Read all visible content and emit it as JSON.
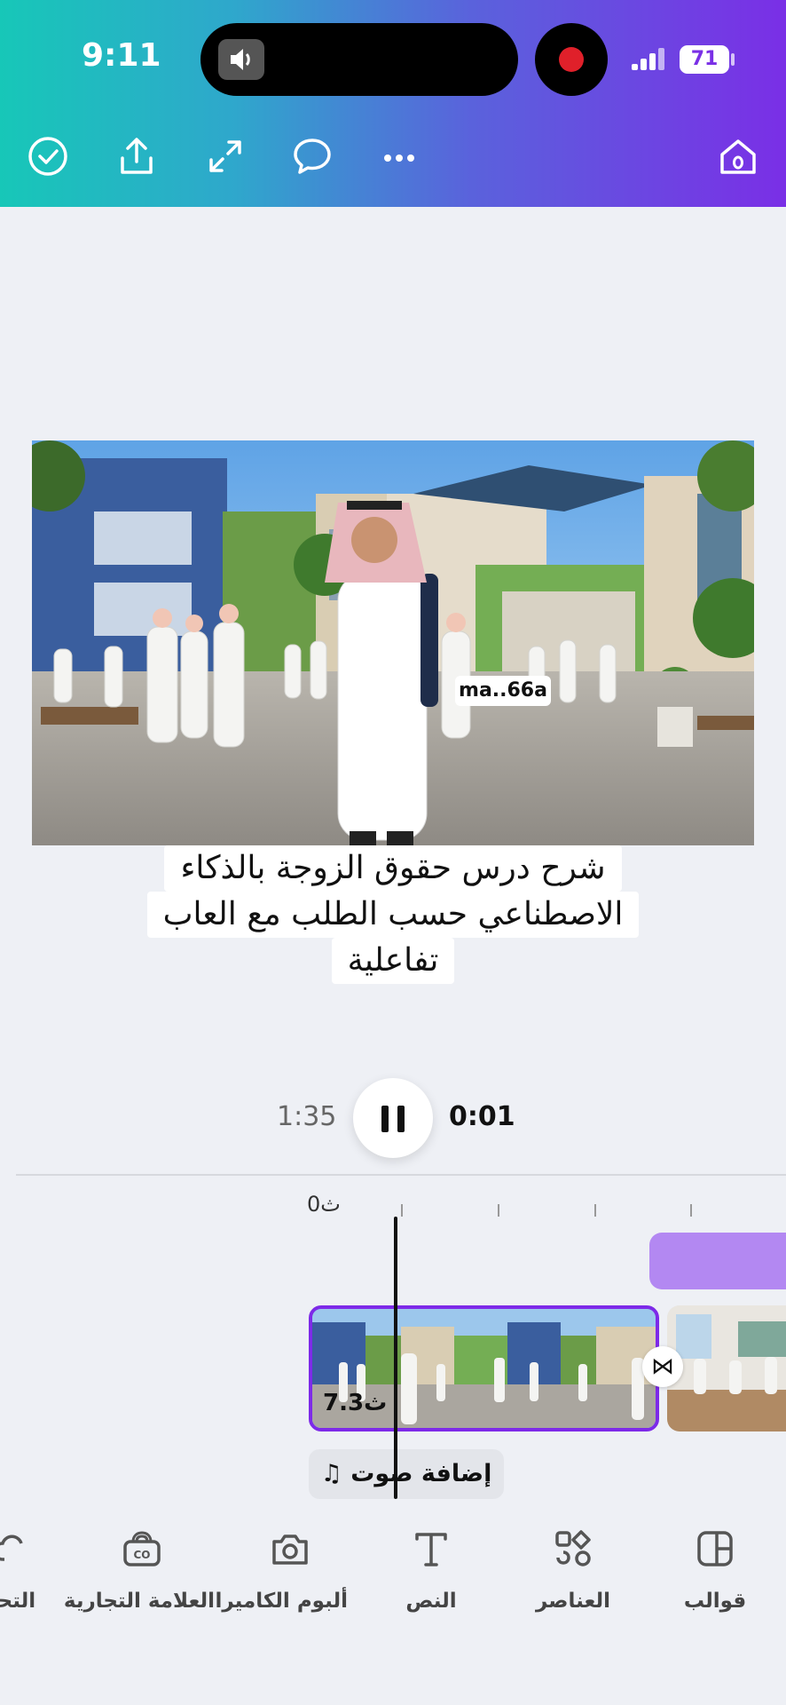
{
  "status_bar": {
    "time": "9:11",
    "battery": "71"
  },
  "toolbar": {
    "icons": [
      "check-icon",
      "share-icon",
      "expand-icon",
      "comment-icon",
      "more-icon",
      "home-icon"
    ]
  },
  "canvas": {
    "tag": "ma..66a",
    "caption_lines": [
      "شرح درس حقوق الزوجة بالذكاء",
      "الاصطناعي حسب الطلب مع العاب",
      "تفاعلية"
    ]
  },
  "player": {
    "total_time": "1:35",
    "current_time": "0:01"
  },
  "timeline": {
    "ruler_start": "0ث",
    "clip_duration": "7.3ث",
    "add_audio": "إضافة صوت"
  },
  "bottom_toolbar": {
    "items": [
      {
        "label": "قوالب",
        "icon": "templates-icon"
      },
      {
        "label": "العناصر",
        "icon": "elements-icon"
      },
      {
        "label": "النص",
        "icon": "text-icon"
      },
      {
        "label": "ألبوم الكاميرا",
        "icon": "camera-icon"
      },
      {
        "label": "العلامة التجارية",
        "icon": "brand-icon"
      },
      {
        "label": "التحـ",
        "icon": "upload-icon"
      }
    ]
  },
  "colors": {
    "accent": "#7d2ae8",
    "gradient_start": "#17c7b8",
    "gradient_end": "#7a2fe6",
    "audio_track": "#b388f2"
  }
}
